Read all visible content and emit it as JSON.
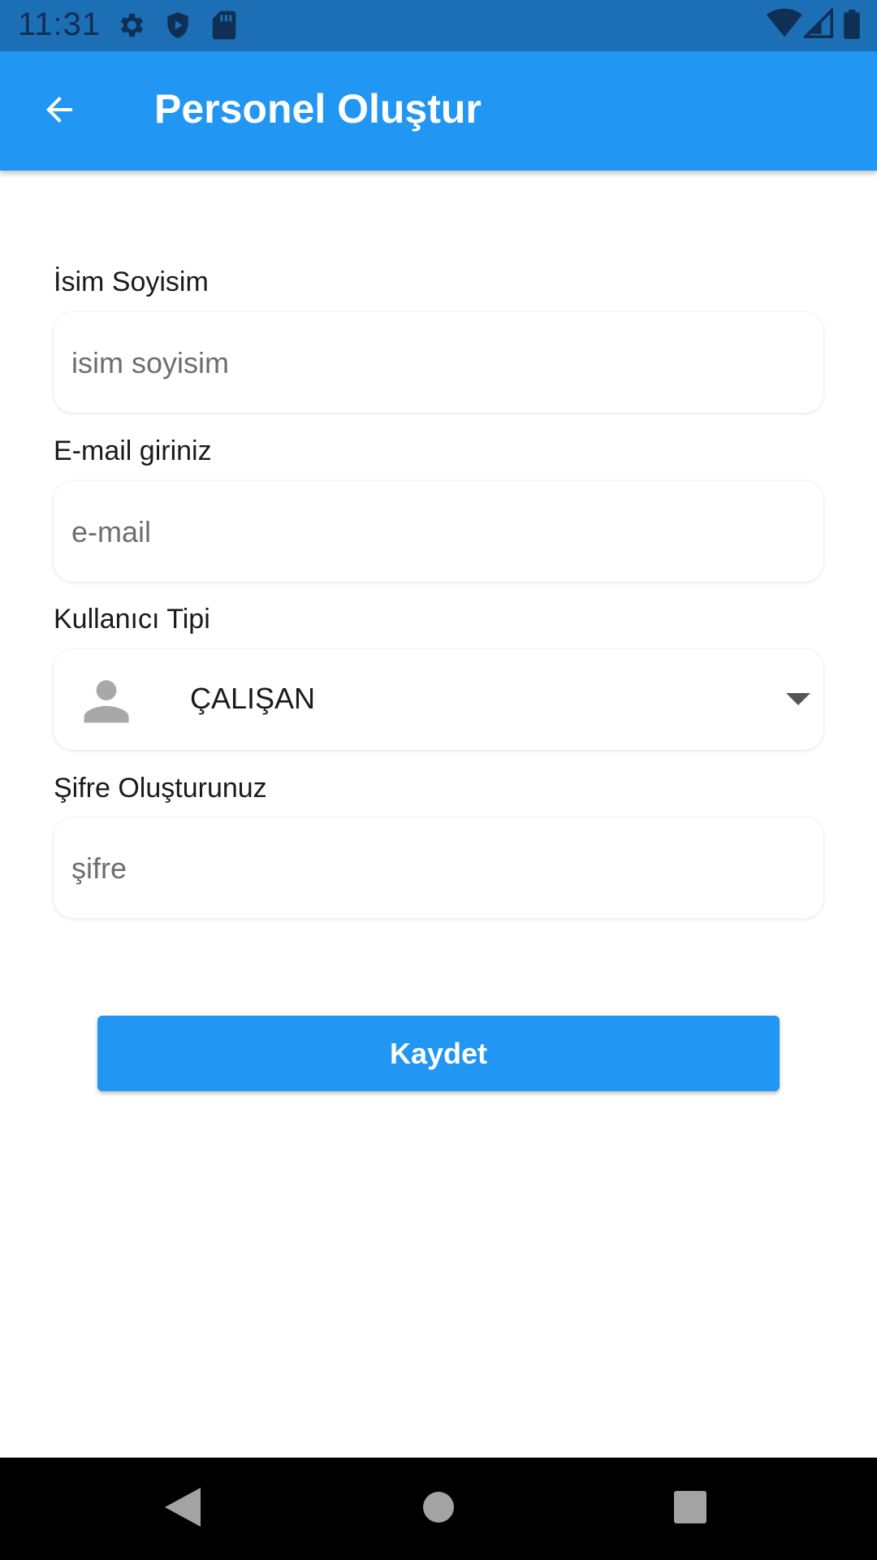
{
  "status_bar": {
    "time": "11:31",
    "icons": [
      "gear-icon",
      "shield-icon",
      "sd-card-icon",
      "wifi-icon",
      "signal-icon",
      "battery-icon"
    ]
  },
  "app_bar": {
    "title": "Personel Oluştur",
    "back_icon": "arrow-back-icon",
    "color": "#2196f3"
  },
  "form": {
    "name": {
      "label": "İsim Soyisim",
      "placeholder": "isim soyisim",
      "value": ""
    },
    "email": {
      "label": "E-mail giriniz",
      "placeholder": "e-mail",
      "value": ""
    },
    "user_type": {
      "label": "Kullanıcı Tipi",
      "selected": "ÇALIŞAN",
      "icon": "person-icon"
    },
    "password": {
      "label": "Şifre Oluşturunuz",
      "placeholder": "şifre",
      "value": ""
    }
  },
  "save_button": {
    "label": "Kaydet"
  },
  "nav_bar": {
    "icons": [
      "back-triangle-icon",
      "home-circle-icon",
      "recents-square-icon"
    ]
  }
}
